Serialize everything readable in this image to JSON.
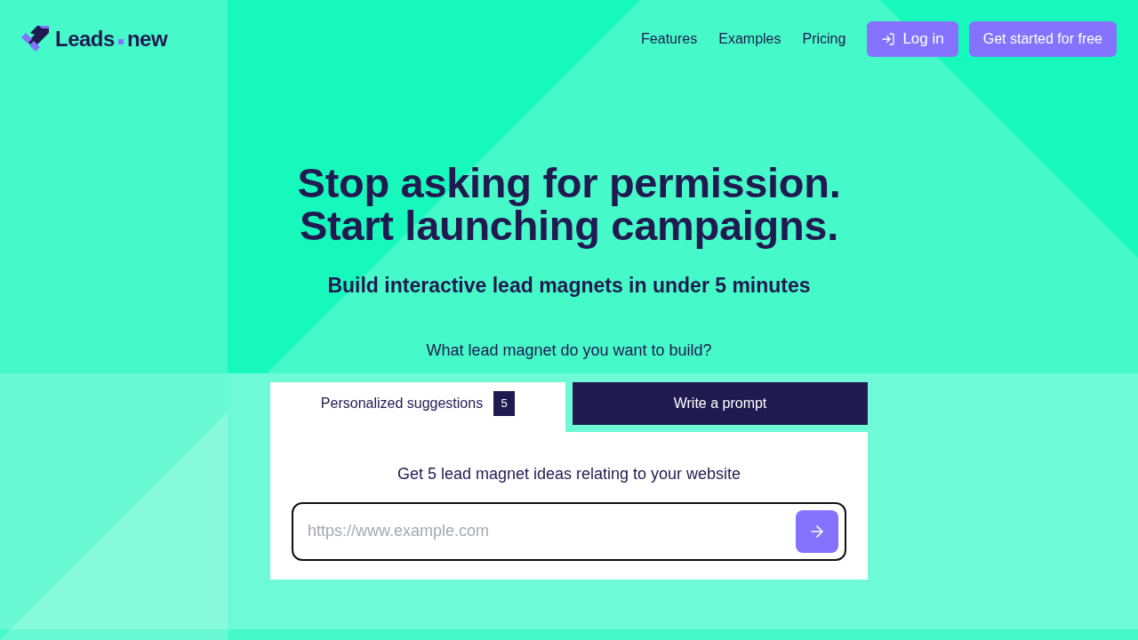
{
  "logo": {
    "words": [
      "Leads",
      "new"
    ]
  },
  "nav": {
    "links": [
      "Features",
      "Examples",
      "Pricing"
    ],
    "buttons": [
      {
        "kind": "login",
        "label": "Log in"
      },
      {
        "kind": "cta",
        "label": "Get started for free"
      }
    ]
  },
  "hero": {
    "title_lines": [
      "Stop asking for permission.",
      "Start launching campaigns."
    ],
    "subtitle": "Build interactive lead magnets in under 5 minutes",
    "question": "What lead magnet do you want to build?"
  },
  "builder": {
    "tabs": [
      {
        "label": "Personalized suggestions",
        "selected": true,
        "badge": "5"
      },
      {
        "label": "Write a prompt",
        "selected": false
      }
    ],
    "prompt": "Get 5 lead magnet ideas relating to your website",
    "url_field": {
      "placeholder": "https://www.example.com"
    }
  }
}
